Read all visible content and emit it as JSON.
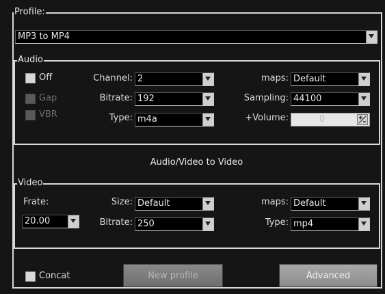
{
  "profile": {
    "legend": "Profile:",
    "selected": "MP3 to MP4"
  },
  "audio": {
    "legend": "Audio",
    "off_label": "Off",
    "gap_label": "Gap",
    "vbr_label": "VBR",
    "channel_label": "Channel:",
    "channel_value": "2",
    "bitrate_label": "Bitrate:",
    "bitrate_value": "192",
    "type_label": "Type:",
    "type_value": "m4a",
    "maps_label": "maps:",
    "maps_value": "Default",
    "sampling_label": "Sampling:",
    "sampling_value": "44100",
    "volume_label": "+Volume:",
    "volume_value": "0"
  },
  "section_title": "Audio/Video to Video",
  "video": {
    "legend": "Video",
    "frate_label": "Frate:",
    "frate_value": "20.00",
    "size_label": "Size:",
    "size_value": "Default",
    "bitrate_label": "Bitrate:",
    "bitrate_value": "250",
    "maps_label": "maps:",
    "maps_value": "Default",
    "type_label": "Type:",
    "type_value": "mp4"
  },
  "bottom": {
    "concat_label": "Concat",
    "new_profile_label": "New profile",
    "advanced_label": "Advanced"
  },
  "colors": {
    "background": "#151515",
    "frame": "#d8d8d8",
    "text": "#e6e6e6",
    "disabled_text": "#6f6f6f"
  }
}
